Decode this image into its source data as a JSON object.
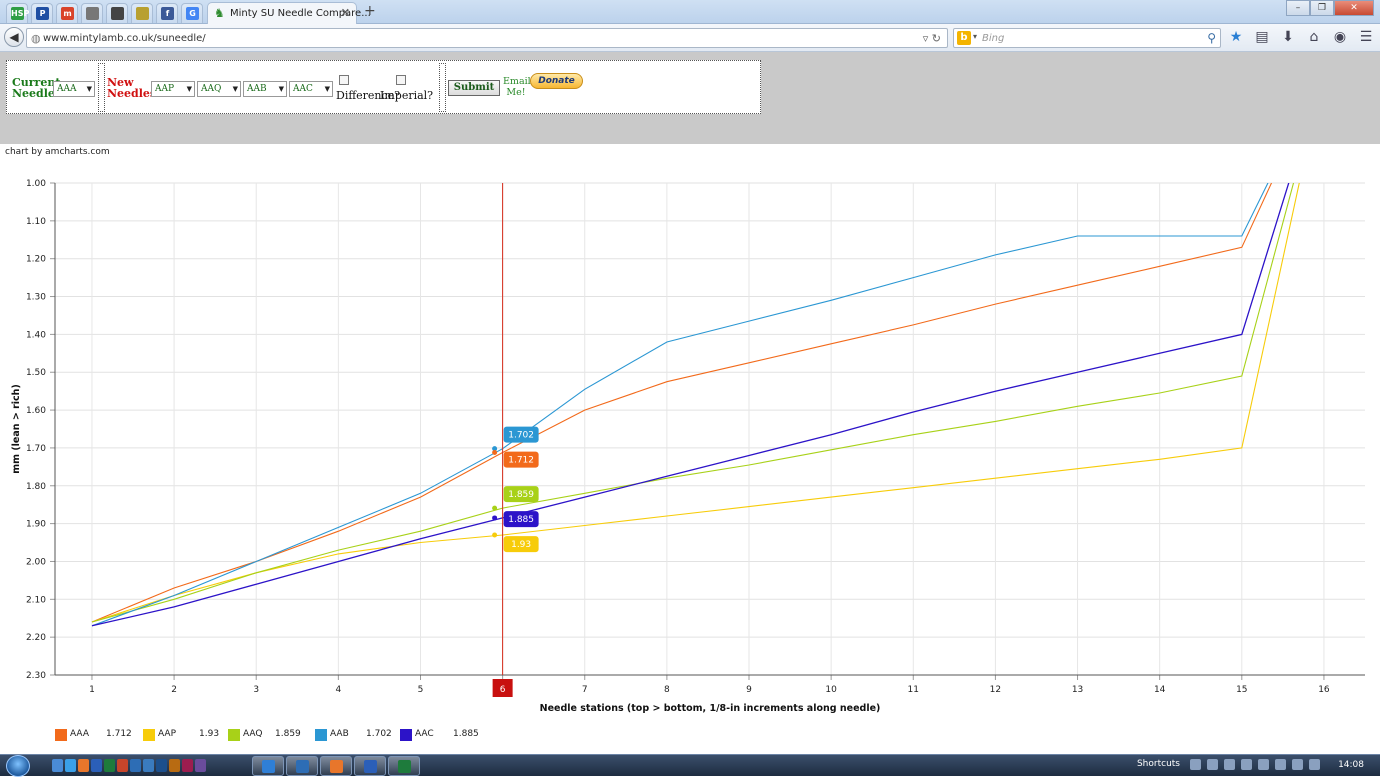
{
  "browser": {
    "tab_title": "Minty SU Needle Compare...",
    "url": "www.mintylamb.co.uk/suneedle/",
    "search_placeholder": "Bing",
    "pinned_tabs": [
      {
        "label": "HSP",
        "color": "#2f9e44"
      },
      {
        "label": "P",
        "color": "#1f4fa3"
      },
      {
        "label": "m",
        "color": "#d9442b"
      },
      {
        "label": "",
        "color": "#777777"
      },
      {
        "label": "",
        "color": "#444444"
      },
      {
        "label": "",
        "color": "#b8a030"
      },
      {
        "label": "f",
        "color": "#3b5998"
      },
      {
        "label": "G",
        "color": "#4285f4"
      }
    ]
  },
  "form": {
    "current_label_1": "Current",
    "current_label_2": "Needle:",
    "current_value": "AAA",
    "new_label_1": "New",
    "new_label_2": "Needles:",
    "new_values": [
      "AAP",
      "AAQ",
      "AAB",
      "AAC"
    ],
    "difference_label": "Difference?",
    "imperial_label": "Imperial?",
    "submit_label": "Submit",
    "email_label_1": "Email",
    "email_label_2": "Me!",
    "donate_label": "Donate"
  },
  "credit": "chart by amcharts.com",
  "chart_data": {
    "type": "line",
    "xlabel": "Needle stations (top > bottom, 1/8-in increments along needle)",
    "ylabel": "mm (lean > rich)",
    "x": [
      1,
      2,
      3,
      4,
      5,
      6,
      7,
      8,
      9,
      10,
      11,
      12,
      13,
      14,
      15,
      16
    ],
    "ylim": [
      1.0,
      2.3
    ],
    "y_reversed": true,
    "y_ticks": [
      "1.00",
      "1.10",
      "1.20",
      "1.30",
      "1.40",
      "1.50",
      "1.60",
      "1.70",
      "1.80",
      "1.90",
      "2.00",
      "2.10",
      "2.20",
      "2.30"
    ],
    "cursor_x": 6,
    "cursor_label": "6",
    "grid": true,
    "series": [
      {
        "name": "AAA",
        "color": "#f26a1b",
        "hover_value": "1.712",
        "values": [
          2.16,
          2.07,
          2.0,
          1.92,
          1.83,
          1.712,
          1.6,
          1.525,
          1.475,
          1.425,
          1.375,
          1.32,
          1.27,
          1.22,
          1.17,
          0.7
        ]
      },
      {
        "name": "AAP",
        "color": "#f7cc0a",
        "hover_value": "1.93",
        "values": [
          2.16,
          2.09,
          2.03,
          1.98,
          1.95,
          1.93,
          1.905,
          1.88,
          1.855,
          1.83,
          1.805,
          1.78,
          1.755,
          1.73,
          1.7,
          0.7
        ]
      },
      {
        "name": "AAQ",
        "color": "#a8d118",
        "hover_value": "1.859",
        "values": [
          2.16,
          2.1,
          2.03,
          1.97,
          1.92,
          1.859,
          1.82,
          1.78,
          1.745,
          1.705,
          1.665,
          1.63,
          1.59,
          1.555,
          1.51,
          0.7
        ]
      },
      {
        "name": "AAB",
        "color": "#2b97d3",
        "hover_value": "1.702",
        "values": [
          2.17,
          2.09,
          2.0,
          1.91,
          1.82,
          1.702,
          1.545,
          1.42,
          1.365,
          1.31,
          1.25,
          1.19,
          1.14,
          1.14,
          1.14,
          0.7
        ]
      },
      {
        "name": "AAC",
        "color": "#2c13c8",
        "hover_value": "1.885",
        "values": [
          2.17,
          2.12,
          2.06,
          2.0,
          1.94,
          1.885,
          1.83,
          1.775,
          1.72,
          1.665,
          1.605,
          1.55,
          1.5,
          1.45,
          1.4,
          0.7
        ]
      }
    ]
  },
  "taskbar": {
    "shortcuts_label": "Shortcuts",
    "time": "14:08"
  }
}
